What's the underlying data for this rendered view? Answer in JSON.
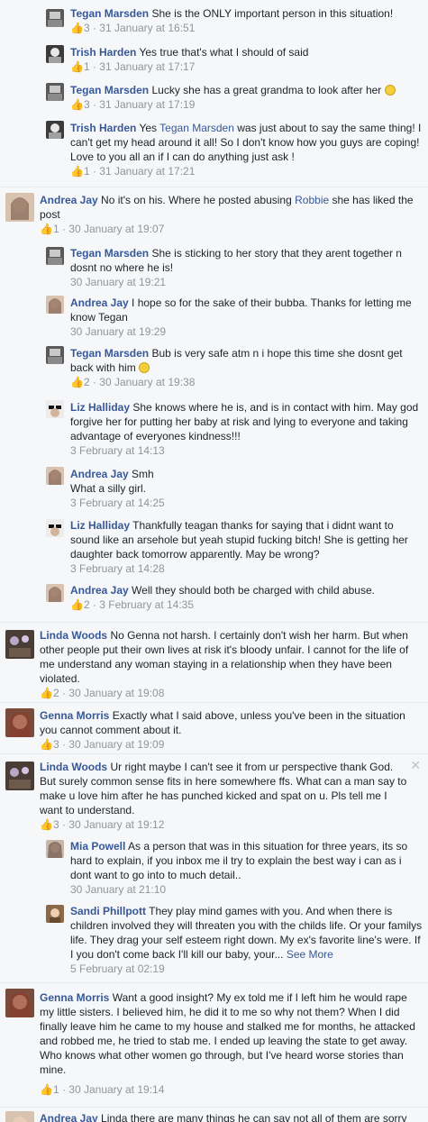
{
  "comments": [
    {
      "name": "Tegan Marsden",
      "text": " She is the ONLY important person in this situation!",
      "meta": "3 · 31 January at 16:51"
    },
    {
      "name": "Trish Harden",
      "text": " Yes true that's what I should of said",
      "meta": "1 · 31 January at 17:17"
    },
    {
      "name": "Tegan Marsden",
      "text": " Lucky she has a great grandma to look after her ",
      "meta": "3 · 31 January at 17:19"
    },
    {
      "name": "Trish Harden",
      "text_a": " Yes ",
      "mention": "Tegan Marsden",
      "text_b": " was just about to say the same thing! I can't get my head around it all! So I don't know how you guys are coping! Love to you all an if I can do anything just ask !",
      "meta": "1 · 31 January at 17:21"
    },
    {
      "name": "Andrea Jay",
      "text_a": " No it's on his. Where he posted abusing ",
      "mention": "Robbie",
      "text_b": " she has liked the post",
      "meta": "1 · 30 January at 19:07"
    },
    {
      "name": "Tegan Marsden",
      "text": " She is sticking to her story that they arent together n dosnt no where he is!",
      "meta": "30 January at 19:21"
    },
    {
      "name": "Andrea Jay",
      "text": " I hope so for the sake of their bubba. Thanks for letting me know Tegan",
      "meta": "30 January at 19:29"
    },
    {
      "name": "Tegan Marsden",
      "text": " Bub is very safe atm n i hope this time she dosnt get back with him ",
      "meta": "2 · 30 January at 19:38"
    },
    {
      "name": "Liz Halliday",
      "text": " She knows where he is, and is in contact with him. May god forgive her for putting her baby at risk and lying to everyone and taking advantage of everyones kindness!!!",
      "meta": "3 February at 14:13"
    },
    {
      "name": "Andrea Jay",
      "text": " Smh",
      "text2": "What a silly girl.",
      "meta": "3 February at 14:25"
    },
    {
      "name": "Liz Halliday",
      "text": " Thankfully teagan thanks for saying that i didnt want to sound like an arsehole but yeah stupid fucking bitch! She is getting her daughter back tomorrow apparently. May be wrong?",
      "meta": "3 February at 14:28"
    },
    {
      "name": "Andrea Jay",
      "text": " Well they should both be charged with child abuse.",
      "meta": "2 · 3 February at 14:35"
    },
    {
      "name": "Linda Woods",
      "text": " No Genna not harsh. I certainly don't wish her harm. But when other people put their own lives at risk it's bloody unfair. I cannot for the life of me understand any woman staying in a relationship when they have been violated.",
      "meta": "2 · 30 January at 19:08"
    },
    {
      "name": "Genna Morris",
      "text": " Exactly what I said above, unless you've been in the situation you cannot comment about it.",
      "meta": "3 · 30 January at 19:09"
    },
    {
      "name": "Linda Woods",
      "text": " Ur right maybe I can't see it from ur perspective thank God. But surely common sense fits in here somewhere ffs. What can a man say to make u love him after he has punched kicked and spat on u. Pls tell me I want to understand.",
      "meta": "3 · 30 January at 19:12"
    },
    {
      "name": "Mia Powell",
      "text": " As a person that was in this situation for three years, its so hard to explain, if you inbox me il try to explain the best way i can as i dont want to go into to much detail..",
      "meta": "30 January at 21:10"
    },
    {
      "name": "Sandi Phillpott",
      "text": " They play mind games with you. And when there is children involved they will threaten you with the childs life. Or your familys life. They drag your self esteem right down. My ex's favorite line's were. If I you don't come back I'll kill our baby, your... ",
      "more": "See More",
      "meta": "5 February at 02:19"
    },
    {
      "name": "Genna Morris",
      "text": " Want a good insight? My ex told me if I left him he would rape my little sisters. I believed him, he did it to me so why not them? When I did finally leave him he came to my house and stalked me for months, he attacked and robbed me, he tried to stab me. I ended up leaving the state to get away.",
      "text2": "Who knows what other women go through, but I've heard worse stories than mine.",
      "meta": "1 · 30 January at 19:14"
    },
    {
      "name": "Andrea Jay",
      "text": " Linda there are many things he can say not all of them are sorry"
    }
  ],
  "like_icon": "thumbs-up-icon",
  "close_glyph": "✕",
  "colors": {
    "link": "#365899",
    "meta": "#90949c",
    "bg": "#f6f7f9"
  }
}
